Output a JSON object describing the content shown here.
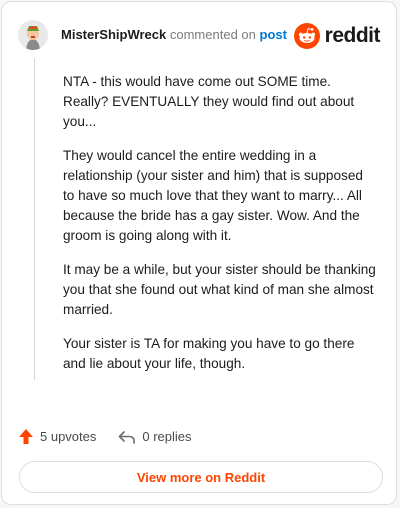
{
  "comment": {
    "username": "MisterShipWreck",
    "action_text": "commented on",
    "post_link": "post",
    "paragraphs": [
      "NTA - this would have come out SOME time. Really? EVENTUALLY they would find out about you...",
      "They would cancel the entire wedding in a relationship (your sister and him) that is supposed to have so much love that they want to marry... All because the bride has a gay sister. Wow. And the groom is going along with it.",
      "It may be a while, but your sister should be thanking you that she found out what kind of man she almost married.",
      "Your sister is TA for making you have to go there and lie about your life, though."
    ]
  },
  "brand": {
    "name": "reddit",
    "icon": "reddit-logo-icon",
    "color": "#ff4500"
  },
  "actions": {
    "upvotes": "5 upvotes",
    "upvote_icon": "upvote-arrow-icon",
    "replies": "0 replies",
    "reply_icon": "reply-arrow-icon"
  },
  "footer": {
    "view_more": "View more on Reddit"
  },
  "colors": {
    "accent": "#ff4500",
    "link": "#0079d3",
    "border": "#dcdfe2"
  }
}
